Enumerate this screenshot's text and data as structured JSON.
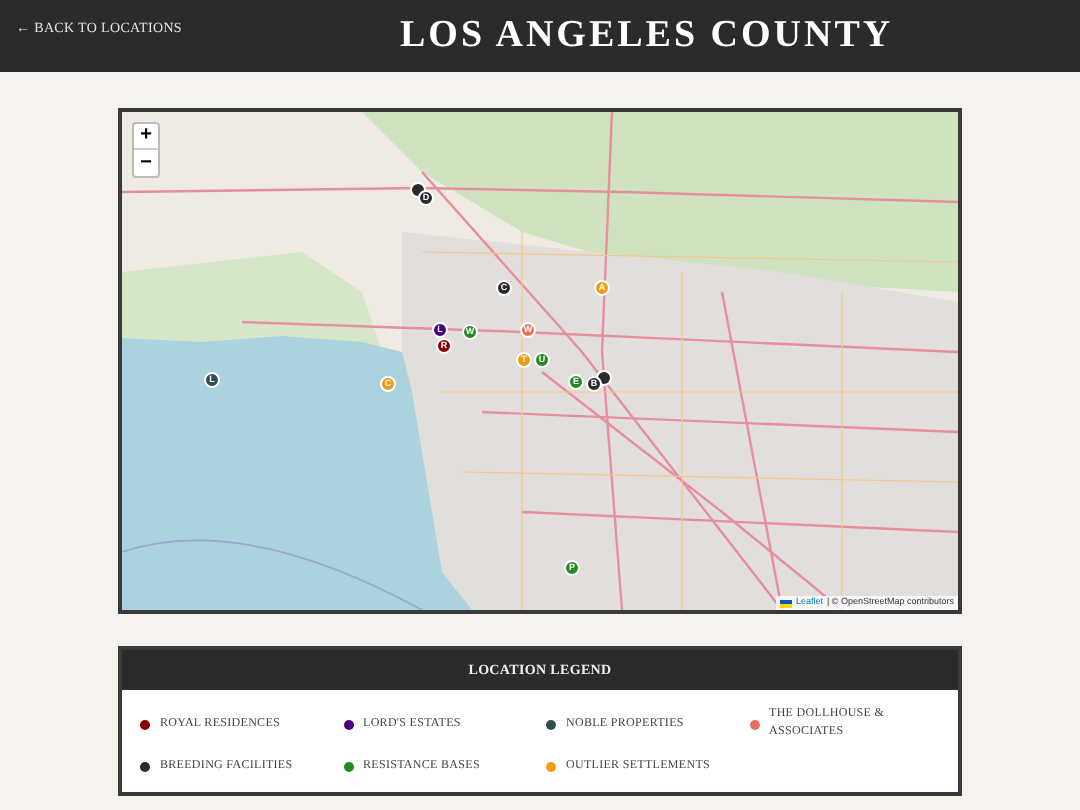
{
  "header": {
    "back_link": "← BACK TO LOCATIONS",
    "title": "LOS ANGELES COUNTY"
  },
  "map": {
    "zoom_controls": [
      "+",
      "−"
    ],
    "markers": [
      {
        "color": "#2b2b2b"
      },
      {
        "letter": "D",
        "color": "#2b2b2b"
      },
      {
        "letter": "C",
        "color": "#2b2b2b"
      },
      {
        "letter": "A",
        "color": "#f39c12"
      },
      {
        "letter": "L",
        "color": "#4b0082"
      },
      {
        "letter": "W",
        "color": "#228b22"
      },
      {
        "letter": "R",
        "color": "#8b0000"
      },
      {
        "letter": "W",
        "color": "#e9705a"
      },
      {
        "letter": "T",
        "color": "#f39c12"
      },
      {
        "letter": "U",
        "color": "#228b22"
      },
      {
        "letter": "L",
        "color": "#2f4f4f"
      },
      {
        "letter": "C",
        "color": "#f39c12"
      },
      {
        "color": "#2b2b2b"
      },
      {
        "letter": "E",
        "color": "#228b22"
      },
      {
        "letter": "B",
        "color": "#2b2b2b"
      },
      {
        "letter": "P",
        "color": "#228b22"
      }
    ],
    "attribution_link": "Leaflet",
    "attribution_text": "| © OpenStreetMap contributors"
  },
  "legend": {
    "title": "LOCATION LEGEND",
    "items": [
      {
        "label": "ROYAL RESIDENCES",
        "color": "#8b0000"
      },
      {
        "label": "LORD'S ESTATES",
        "color": "#4b0082"
      },
      {
        "label": "NOBLE PROPERTIES",
        "color": "#2f4f4f"
      },
      {
        "label": "THE DOLLHOUSE & ASSOCIATES",
        "color": "#e9705a"
      },
      {
        "label": "BREEDING FACILITIES",
        "color": "#2b2b2b"
      },
      {
        "label": "RESISTANCE BASES",
        "color": "#228b22"
      },
      {
        "label": "OUTLIER SETTLEMENTS",
        "color": "#f39c12"
      }
    ]
  }
}
